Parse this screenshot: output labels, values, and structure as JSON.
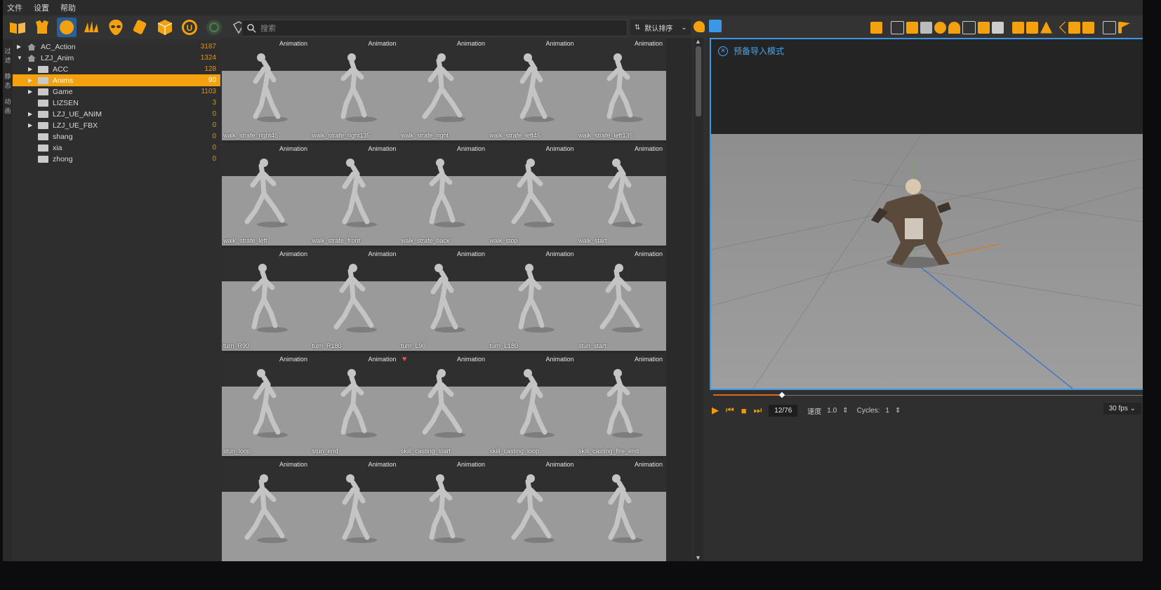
{
  "menu": [
    "文件",
    "设置",
    "帮助"
  ],
  "toolbar": {
    "icons": [
      "book-icon",
      "armor-icon",
      "orb-icon",
      "bars-icon",
      "alien-icon",
      "scroll-icon",
      "cube-icon",
      "unreal-icon",
      "record-icon",
      "diamond-icon"
    ],
    "search_placeholder": "搜索",
    "sort_label": "默认排序"
  },
  "side_strip": [
    "过滤",
    "静态",
    "动画"
  ],
  "tree": [
    {
      "label": "AC_Action",
      "count": "3187",
      "level": 0,
      "expanded": false,
      "home": true
    },
    {
      "label": "LZJ_Anim",
      "count": "1324",
      "level": 0,
      "expanded": true,
      "home": true
    },
    {
      "label": "ACC",
      "count": "128",
      "level": 1,
      "expanded": false
    },
    {
      "label": "Anims",
      "count": "90",
      "level": 1,
      "expanded": false,
      "selected": true
    },
    {
      "label": "Game",
      "count": "1103",
      "level": 1,
      "expanded": false
    },
    {
      "label": "LIZSEN",
      "count": "3",
      "level": 1
    },
    {
      "label": "LZJ_UE_ANIM",
      "count": "0",
      "level": 1,
      "expanded": false
    },
    {
      "label": "LZJ_UE_FBX",
      "count": "0",
      "level": 1,
      "expanded": false
    },
    {
      "label": "shang",
      "count": "0",
      "level": 1
    },
    {
      "label": "xia",
      "count": "0",
      "level": 1
    },
    {
      "label": "zhong",
      "count": "0",
      "level": 1
    }
  ],
  "assets": [
    {
      "name": "walk_strafe_right45",
      "tag": "Animation"
    },
    {
      "name": "walk_strafe_right135",
      "tag": "Animation"
    },
    {
      "name": "walk_strafe_right",
      "tag": "Animation"
    },
    {
      "name": "walk_strafe_left45",
      "tag": "Animation"
    },
    {
      "name": "walk_strafe_left135",
      "tag": "Animation"
    },
    {
      "name": "walk_strafe_left",
      "tag": "Animation"
    },
    {
      "name": "walk_strafe_front",
      "tag": "Animation"
    },
    {
      "name": "walk_strafe_back",
      "tag": "Animation"
    },
    {
      "name": "walk_stop",
      "tag": "Animation"
    },
    {
      "name": "walk_start",
      "tag": "Animation"
    },
    {
      "name": "turn_R90",
      "tag": "Animation"
    },
    {
      "name": "turn_R180",
      "tag": "Animation"
    },
    {
      "name": "turn_L90",
      "tag": "Animation"
    },
    {
      "name": "turn_L180",
      "tag": "Animation"
    },
    {
      "name": "stun_start",
      "tag": "Animation"
    },
    {
      "name": "stun_loop",
      "tag": "Animation"
    },
    {
      "name": "stun_end",
      "tag": "Animation"
    },
    {
      "name": "skill_casting_start",
      "tag": "Animation",
      "favorite": true
    },
    {
      "name": "skill_casting_loop",
      "tag": "Animation"
    },
    {
      "name": "skill_casting_fire_end",
      "tag": "Animation"
    },
    {
      "name": "",
      "tag": "Animation"
    },
    {
      "name": "",
      "tag": "Animation"
    },
    {
      "name": "",
      "tag": "Animation"
    },
    {
      "name": "",
      "tag": "Animation"
    },
    {
      "name": "",
      "tag": "Animation"
    }
  ],
  "viewport": {
    "mode_label": "预备导入模式"
  },
  "playback": {
    "frame": "12/76",
    "progress": 0.16,
    "speed_label": "速度",
    "speed_value": "1.0",
    "cycles_label": "Cycles:",
    "cycles_value": "1",
    "fps": "30 fps"
  },
  "colors": {
    "accent": "#f3a10f",
    "viewport_border": "#3b98e6",
    "count_text": "#e0911a"
  }
}
